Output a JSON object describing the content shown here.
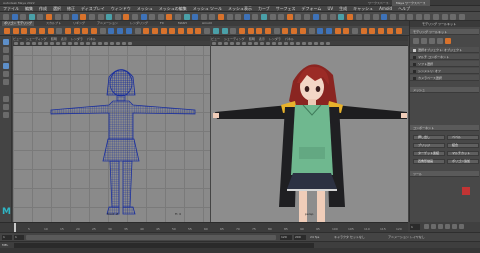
{
  "title_bar": {
    "left": "Autodesk Maya 2022",
    "center": "Maya ワークスペース",
    "right_label": "ワークスペース:"
  },
  "menu": [
    "ファイル",
    "編集",
    "作成",
    "選択",
    "修正",
    "ディスプレイ",
    "ウィンドウ",
    "メッシュ",
    "メッシュの編集",
    "メッシュ ツール",
    "メッシュ表示",
    "カーブ",
    "サーフェス",
    "デフォーム",
    "UV",
    "生成",
    "キャッシュ",
    "Arnold",
    "ヘルプ"
  ],
  "shelf_tabs": [
    "ポリゴン モデリング",
    "スカルプト",
    "リギング",
    "アニメーション",
    "レンダリング",
    "FX",
    "MASH",
    "Arnold"
  ],
  "left_viewport": {
    "menu": [
      "ビュー",
      "シェーディング",
      "照明",
      "表示",
      "レンダラ",
      "パネル"
    ],
    "camera": "front -Z",
    "frame_label": "Fi: 0"
  },
  "right_viewport": {
    "menu": [
      "ビュー",
      "シェーディング",
      "照明",
      "表示",
      "レンダラ",
      "パネル"
    ],
    "camera": "persp"
  },
  "side_panel": {
    "tabs": [
      "モデリング ツールキット"
    ],
    "header": "モデリング ツールキット",
    "rows": [
      {
        "label": "選択オブジェクト: オブジェクト",
        "check": true
      },
      {
        "label": "マルチ コンポーネント",
        "check": false
      },
      {
        "label": "ソフト選択",
        "check": false
      },
      {
        "label": "シンメトリ: オフ",
        "check": false
      },
      {
        "label": "カメラベース選択",
        "check": false
      }
    ],
    "sections": [
      "メッシュ",
      "コンポーネント",
      "ツール"
    ],
    "buttons": [
      "押し出し",
      "ベベル",
      "ブリッジ",
      "結合",
      "ターゲット連結",
      "マルチカット",
      "四角形描画",
      "ポリゴン追加"
    ]
  },
  "timeline": {
    "ticks": [
      "5",
      "10",
      "15",
      "20",
      "25",
      "30",
      "35",
      "40",
      "45",
      "50",
      "55",
      "60",
      "65",
      "70",
      "75",
      "80",
      "85",
      "90",
      "95",
      "100",
      "105",
      "110",
      "115",
      "120"
    ],
    "current_frame": "1"
  },
  "range_bar": {
    "start": "1",
    "end": "120",
    "range_end": "200",
    "fps": "24 fps",
    "char_set": "キャラクタ セットなし",
    "anim_layer": "アニメーション レイヤなし"
  },
  "status_line": "MEL",
  "colors": {
    "accent_orange": "#d8722c",
    "viewport_grid": "#8a8a8a",
    "wireframe_blue": "#1a2f9e",
    "hoodie_green": "#6fb88f",
    "hair_red": "#9b2b26",
    "maya_teal": "#2fb5c4"
  }
}
